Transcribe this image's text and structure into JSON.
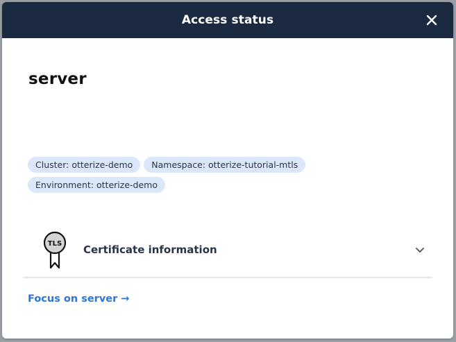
{
  "modal": {
    "title": "Access status",
    "close_icon": "close-icon"
  },
  "service": {
    "name": "server"
  },
  "tags": [
    "Cluster: otterize-demo",
    "Namespace: otterize-tutorial-mtls",
    "Environment: otterize-demo"
  ],
  "certificate": {
    "badge_text": "TLS",
    "label": "Certificate information",
    "icon": "tls-ribbon-icon",
    "expand_icon": "chevron-down-icon"
  },
  "focus_link": {
    "label": "Focus on server →"
  },
  "colors": {
    "header_bg": "#1c2a41",
    "tag_bg": "#dbe8fb",
    "link": "#2f74d8"
  }
}
